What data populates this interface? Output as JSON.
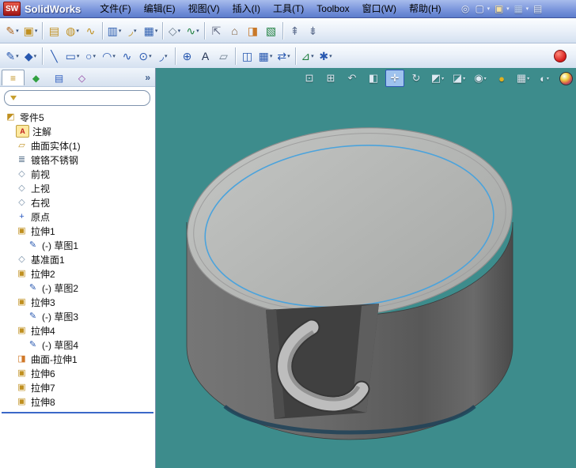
{
  "app": {
    "logo_text": "SW",
    "brand": "SolidWorks"
  },
  "menubar": {
    "items": [
      {
        "name": "menu-file",
        "label": "文件(F)"
      },
      {
        "name": "menu-edit",
        "label": "编辑(E)"
      },
      {
        "name": "menu-view",
        "label": "视图(V)"
      },
      {
        "name": "menu-insert",
        "label": "插入(I)"
      },
      {
        "name": "menu-tools",
        "label": "工具(T)"
      },
      {
        "name": "menu-toolbox",
        "label": "Toolbox"
      },
      {
        "name": "menu-window",
        "label": "窗口(W)"
      },
      {
        "name": "menu-help",
        "label": "帮助(H)"
      }
    ]
  },
  "titlebar_icons": [
    {
      "name": "search",
      "glyph": "◎",
      "color": "#e8eef8"
    },
    {
      "name": "new-document",
      "glyph": "▢",
      "color": "#f0f4ff",
      "dd": true
    },
    {
      "name": "open-document",
      "glyph": "▣",
      "color": "#f5e0a0",
      "dd": true
    },
    {
      "name": "save",
      "glyph": "▦",
      "color": "#bcd0f0",
      "dd": true
    },
    {
      "name": "print",
      "glyph": "▤",
      "color": "#e0e8f4"
    }
  ],
  "toolbar_row1": [
    {
      "name": "sketch-flyout",
      "glyph": "✎",
      "color": "#b06820",
      "dd": true
    },
    {
      "name": "features-flyout",
      "glyph": "▣",
      "color": "#c09020",
      "dd": true
    },
    {
      "sep": true
    },
    {
      "name": "extruded-boss",
      "glyph": "▤",
      "color": "#c09020"
    },
    {
      "name": "revolved-boss",
      "glyph": "◍",
      "color": "#c09020",
      "dd": true
    },
    {
      "name": "swept-boss",
      "glyph": "∿",
      "color": "#c09020"
    },
    {
      "sep": true
    },
    {
      "name": "extruded-cut",
      "glyph": "▥",
      "color": "#3060b0",
      "dd": true
    },
    {
      "name": "fillet",
      "glyph": "◞",
      "color": "#c09020",
      "dd": true
    },
    {
      "name": "linear-pattern",
      "glyph": "▦",
      "color": "#3060b0",
      "dd": true
    },
    {
      "sep": true
    },
    {
      "name": "reference-geometry",
      "glyph": "◇",
      "color": "#708090",
      "dd": true
    },
    {
      "name": "curves",
      "glyph": "∿",
      "color": "#208040",
      "dd": true
    },
    {
      "sep": true
    },
    {
      "name": "instant3d",
      "glyph": "⇱",
      "color": "#606880"
    },
    {
      "name": "mold-tools",
      "glyph": "⌂",
      "color": "#806040"
    },
    {
      "name": "surfaces",
      "glyph": "◨",
      "color": "#c87828"
    },
    {
      "name": "sheet-metal",
      "glyph": "▧",
      "color": "#208040"
    },
    {
      "sep": true
    },
    {
      "name": "dock-up",
      "glyph": "⇞",
      "color": "#607090"
    },
    {
      "name": "dock-down",
      "glyph": "⇟",
      "color": "#607090"
    }
  ],
  "toolbar_row2": [
    {
      "name": "smart-dimension",
      "glyph": "✎",
      "color": "#2858b0",
      "dd": true
    },
    {
      "name": "sketch-tools",
      "glyph": "◆",
      "color": "#2858b0",
      "dd": true
    },
    {
      "sep": true
    },
    {
      "name": "line",
      "glyph": "╲",
      "color": "#2858b0"
    },
    {
      "name": "rectangle",
      "glyph": "▭",
      "color": "#2858b0",
      "dd": true
    },
    {
      "name": "circle",
      "glyph": "○",
      "color": "#2858b0",
      "dd": true
    },
    {
      "name": "arc",
      "glyph": "◠",
      "color": "#2858b0",
      "dd": true
    },
    {
      "name": "spline",
      "glyph": "∿",
      "color": "#2858b0"
    },
    {
      "name": "ellipse",
      "glyph": "⊙",
      "color": "#2858b0",
      "dd": true
    },
    {
      "name": "sketch-fillet",
      "glyph": "◞",
      "color": "#2858b0",
      "dd": true
    },
    {
      "sep": true
    },
    {
      "name": "point",
      "glyph": "⊕",
      "color": "#2858b0"
    },
    {
      "name": "text",
      "glyph": "A",
      "color": "#203050"
    },
    {
      "name": "plane-tool",
      "glyph": "▱",
      "color": "#708090"
    },
    {
      "sep": true
    },
    {
      "name": "mirror-entities",
      "glyph": "◫",
      "color": "#2858b0"
    },
    {
      "name": "sketch-pattern",
      "glyph": "▦",
      "color": "#2858b0",
      "dd": true
    },
    {
      "name": "move-entities",
      "glyph": "⇄",
      "color": "#2858b0",
      "dd": true
    },
    {
      "sep": true
    },
    {
      "name": "display-relations",
      "glyph": "⊿",
      "color": "#208040",
      "dd": true
    },
    {
      "name": "quick-snaps",
      "glyph": "✱",
      "color": "#2858b0",
      "dd": true
    },
    {
      "record": true,
      "name": "record-button"
    }
  ],
  "hud": {
    "items": [
      {
        "name": "zoom-fit",
        "glyph": "⊡"
      },
      {
        "name": "zoom-area",
        "glyph": "⊞"
      },
      {
        "name": "previous-view",
        "glyph": "↶"
      },
      {
        "name": "section-view",
        "glyph": "◧"
      },
      {
        "name": "pan",
        "glyph": "✛",
        "active": true
      },
      {
        "name": "rotate-view",
        "glyph": "↻"
      },
      {
        "name": "view-orientation",
        "glyph": "◩",
        "dd": true
      },
      {
        "name": "display-style",
        "glyph": "◪",
        "dd": true
      },
      {
        "name": "hide-show-items",
        "glyph": "◉",
        "dd": true
      },
      {
        "name": "edit-appearance",
        "glyph": "●",
        "color": "#e0b020"
      },
      {
        "name": "apply-scene",
        "glyph": "▦",
        "dd": true
      },
      {
        "name": "view-settings",
        "glyph": "◐",
        "dd": true
      },
      {
        "name": "render-ball",
        "ball": true
      }
    ]
  },
  "panel": {
    "tabs": [
      {
        "name": "tab-featuremanager",
        "glyph": "≡",
        "color": "#c09020",
        "active": true
      },
      {
        "name": "tab-propertymanager",
        "glyph": "◆",
        "color": "#30a040"
      },
      {
        "name": "tab-configurationmanager",
        "glyph": "▤",
        "color": "#3060c0"
      },
      {
        "name": "tab-dimxpertmanager",
        "glyph": "◇",
        "color": "#9040a0"
      }
    ],
    "expand_chevron": "»"
  },
  "tree_icons": {
    "part": {
      "g": "◩",
      "c": "#c09020"
    },
    "annotations": {
      "g": "A",
      "c": "#c02020",
      "bg": "#ffe9a0"
    },
    "surface-folder": {
      "g": "▱",
      "c": "#c09020"
    },
    "material": {
      "g": "≣",
      "c": "#607890"
    },
    "plane": {
      "g": "◇",
      "c": "#7890a8"
    },
    "origin": {
      "g": "+",
      "c": "#2858c0"
    },
    "extrude": {
      "g": "▣",
      "c": "#c09020"
    },
    "sketch": {
      "g": "✎",
      "c": "#2858b0"
    },
    "surface-extrude": {
      "g": "◨",
      "c": "#d07828"
    }
  },
  "tree": {
    "items": [
      {
        "name": "tree-item-part5",
        "label": "零件5",
        "icon": "part",
        "indent": 0
      },
      {
        "name": "tree-item-annotations",
        "label": "注解",
        "icon": "annotations",
        "indent": 1
      },
      {
        "name": "tree-item-surface-bodies",
        "label": "曲面实体(1)",
        "icon": "surface-folder",
        "indent": 1
      },
      {
        "name": "tree-item-material",
        "label": "镀铬不锈钢",
        "icon": "material",
        "indent": 1
      },
      {
        "name": "tree-item-front-plane",
        "label": "前视",
        "icon": "plane",
        "indent": 1
      },
      {
        "name": "tree-item-top-plane",
        "label": "上视",
        "icon": "plane",
        "indent": 1
      },
      {
        "name": "tree-item-right-plane",
        "label": "右视",
        "icon": "plane",
        "indent": 1
      },
      {
        "name": "tree-item-origin",
        "label": "原点",
        "icon": "origin",
        "indent": 1
      },
      {
        "name": "tree-item-extrude1",
        "label": "拉伸1",
        "icon": "extrude",
        "indent": 1
      },
      {
        "name": "tree-item-sketch1",
        "label": "(-) 草图1",
        "icon": "sketch",
        "indent": 2
      },
      {
        "name": "tree-item-plane1",
        "label": "基准面1",
        "icon": "plane",
        "indent": 1
      },
      {
        "name": "tree-item-extrude2",
        "label": "拉伸2",
        "icon": "extrude",
        "indent": 1
      },
      {
        "name": "tree-item-sketch2",
        "label": "(-) 草图2",
        "icon": "sketch",
        "indent": 2
      },
      {
        "name": "tree-item-extrude3",
        "label": "拉伸3",
        "icon": "extrude",
        "indent": 1
      },
      {
        "name": "tree-item-sketch3",
        "label": "(-) 草图3",
        "icon": "sketch",
        "indent": 2
      },
      {
        "name": "tree-item-extrude4",
        "label": "拉伸4",
        "icon": "extrude",
        "indent": 1
      },
      {
        "name": "tree-item-sketch4",
        "label": "(-) 草图4",
        "icon": "sketch",
        "indent": 2
      },
      {
        "name": "tree-item-surface-extrude1",
        "label": "曲面-拉伸1",
        "icon": "surface-extrude",
        "indent": 1
      },
      {
        "name": "tree-item-extrude6",
        "label": "拉伸6",
        "icon": "extrude",
        "indent": 1
      },
      {
        "name": "tree-item-extrude7",
        "label": "拉伸7",
        "icon": "extrude",
        "indent": 1
      },
      {
        "name": "tree-item-extrude8",
        "label": "拉伸8",
        "icon": "extrude",
        "indent": 1
      }
    ]
  },
  "viewport": {
    "background": "#3d8c8c"
  },
  "model": {
    "top_face_color": "#b8bab8",
    "side_color": "#616161",
    "sketch_color": "#4ba3dc"
  }
}
